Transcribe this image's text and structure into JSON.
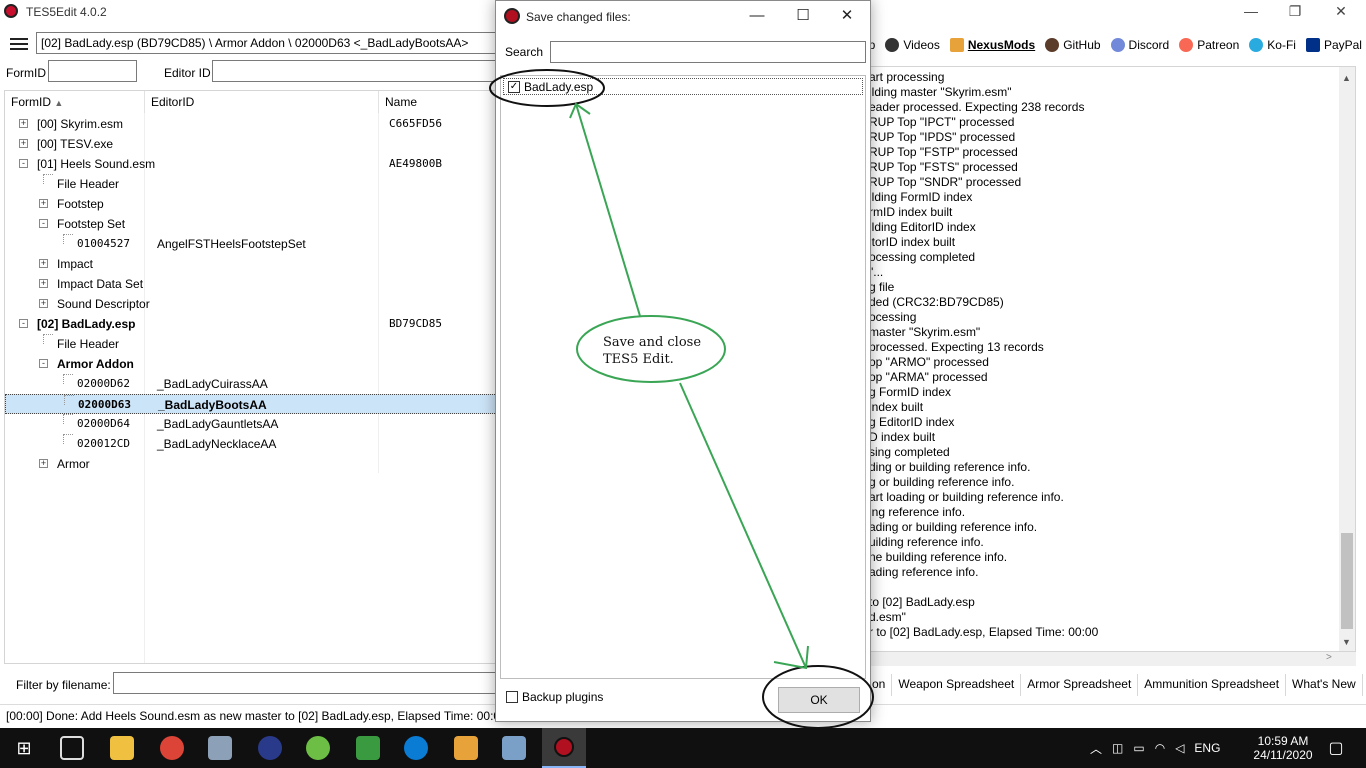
{
  "window": {
    "title": "TES5Edit 4.0.2",
    "controls": [
      "—",
      "❐",
      "✕"
    ]
  },
  "toolbar": {
    "path": "[02] BadLady.esp (BD79CD85) \\ Armor Addon \\ 02000D63 <_BadLadyBootsAA>",
    "links": [
      {
        "label": "lp",
        "icon": "help-icon",
        "color": "#ffffff"
      },
      {
        "label": "Videos",
        "icon": "video-icon",
        "color": "#333333"
      },
      {
        "label": "NexusMods",
        "icon": "nexusmods-icon",
        "color": "#e8a23a"
      },
      {
        "label": "GitHub",
        "icon": "github-icon",
        "color": "#5b3b2a"
      },
      {
        "label": "Discord",
        "icon": "discord-icon",
        "color": "#7289da"
      },
      {
        "label": "Patreon",
        "icon": "patreon-icon",
        "color": "#f96854"
      },
      {
        "label": "Ko-Fi",
        "icon": "kofi-icon",
        "color": "#29abe0"
      },
      {
        "label": "PayPal",
        "icon": "paypal-icon",
        "color": "#003087"
      }
    ]
  },
  "filters": {
    "formid_label": "FormID",
    "editorid_label": "Editor ID"
  },
  "tree": {
    "columns": [
      "FormID",
      "EditorID",
      "Name"
    ],
    "rows": [
      {
        "indent": 0,
        "pm": "+",
        "label": "[00] Skyrim.esm",
        "editor": "",
        "name": "C665FD56",
        "bold": false
      },
      {
        "indent": 0,
        "pm": "+",
        "label": "[00] TESV.exe",
        "editor": "",
        "name": "",
        "bold": false
      },
      {
        "indent": 0,
        "pm": "-",
        "label": "[01] Heels Sound.esm",
        "editor": "",
        "name": "AE49800B",
        "bold": false
      },
      {
        "indent": 1,
        "pm": "",
        "label": "File Header",
        "editor": "",
        "name": "",
        "bold": false
      },
      {
        "indent": 1,
        "pm": "+",
        "label": "Footstep",
        "editor": "",
        "name": "",
        "bold": false
      },
      {
        "indent": 1,
        "pm": "-",
        "label": "Footstep Set",
        "editor": "",
        "name": "",
        "bold": false
      },
      {
        "indent": 2,
        "pm": "",
        "label": "01004527",
        "editor": "AngelFSTHeelsFootstepSet",
        "name": "",
        "bold": false
      },
      {
        "indent": 1,
        "pm": "+",
        "label": "Impact",
        "editor": "",
        "name": "",
        "bold": false
      },
      {
        "indent": 1,
        "pm": "+",
        "label": "Impact Data Set",
        "editor": "",
        "name": "",
        "bold": false
      },
      {
        "indent": 1,
        "pm": "+",
        "label": "Sound Descriptor",
        "editor": "",
        "name": "",
        "bold": false
      },
      {
        "indent": 0,
        "pm": "-",
        "label": "[02] BadLady.esp",
        "editor": "",
        "name": "BD79CD85",
        "bold": true
      },
      {
        "indent": 1,
        "pm": "",
        "label": "File Header",
        "editor": "",
        "name": "",
        "bold": false
      },
      {
        "indent": 1,
        "pm": "-",
        "label": "Armor Addon",
        "editor": "",
        "name": "",
        "bold": true
      },
      {
        "indent": 2,
        "pm": "",
        "label": "02000D62",
        "editor": "_BadLadyCuirassAA",
        "name": "",
        "bold": false
      },
      {
        "indent": 2,
        "pm": "",
        "label": "02000D63",
        "editor": "_BadLadyBootsAA",
        "name": "",
        "bold": true,
        "selected": true
      },
      {
        "indent": 2,
        "pm": "",
        "label": "02000D64",
        "editor": "_BadLadyGauntletsAA",
        "name": "",
        "bold": false
      },
      {
        "indent": 2,
        "pm": "",
        "label": "020012CD",
        "editor": "_BadLadyNecklaceAA",
        "name": "",
        "bold": false
      },
      {
        "indent": 1,
        "pm": "+",
        "label": "Armor",
        "editor": "",
        "name": "",
        "bold": false
      }
    ]
  },
  "log": {
    "lines": [
      "art processing",
      "ilding master \"Skyrim.esm\"",
      "eader processed. Expecting 238 records",
      "RUP Top \"IPCT\" processed",
      "RUP Top \"IPDS\" processed",
      "RUP Top \"FSTP\" processed",
      "RUP Top \"FSTS\" processed",
      "RUP Top \"SNDR\" processed",
      "ilding FormID index",
      "rmID index built",
      "ilding EditorID index",
      "itorID index built",
      "ocessing completed",
      "\"...",
      "g file",
      "ded (CRC32:BD79CD85)",
      "ocessing",
      " master \"Skyrim.esm\"",
      " processed. Expecting 13 records",
      "op \"ARMO\" processed",
      "op \"ARMA\" processed",
      "g FormID index",
      " index built",
      "g EditorID index",
      "D index built",
      "sing completed",
      "ding or building reference info.",
      "g or building reference info.",
      "art loading or building reference info.",
      "ing reference info.",
      "ading or building reference info.",
      "uilding reference info.",
      "ne building reference info.",
      "ading reference info.",
      "",
      " to [02] BadLady.esp",
      "d.esm\"",
      "r to [02] BadLady.esp, Elapsed Time: 00:00"
    ]
  },
  "bottom": {
    "filter_label": "Filter by filename:",
    "tabs": [
      "on",
      "Weapon Spreadsheet",
      "Armor Spreadsheet",
      "Ammunition Spreadsheet",
      "What's New"
    ],
    "status": "[00:00] Done: Add Heels Sound.esm as new master to [02] BadLady.esp, Elapsed Time: 00:00"
  },
  "dialog": {
    "title": "Save changed files:",
    "search_label": "Search",
    "files": [
      {
        "name": "BadLady.esp",
        "checked": true
      }
    ],
    "backup_label": "Backup plugins",
    "ok_label": "OK",
    "check_mark": "✓"
  },
  "annotation": {
    "note_line1": "Save and close",
    "note_line2": "TES5 Edit.",
    "color": "#3aa655"
  },
  "taskbar": {
    "tray": {
      "lang": "ENG",
      "time": "10:59 AM",
      "date": "24/11/2020"
    }
  }
}
